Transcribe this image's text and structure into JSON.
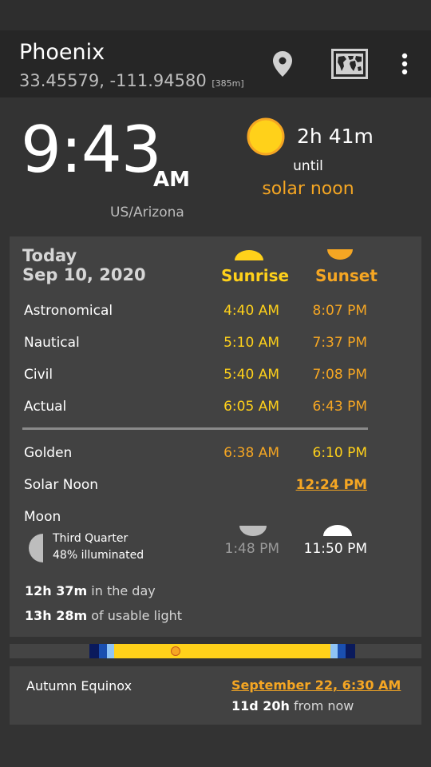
{
  "location": {
    "name": "Phoenix",
    "coordinates": "33.45579, -111.94580",
    "elevation": "[385m]"
  },
  "toolbar_icons": [
    "location-pin-icon",
    "world-map-icon",
    "more-vert-icon"
  ],
  "clock": {
    "time": "9:43",
    "ampm": "AM",
    "timezone": "US/Arizona"
  },
  "next_event": {
    "countdown": "2h 41m",
    "until": "until",
    "target": "solar noon"
  },
  "today": {
    "day_label": "Today",
    "date": "Sep 10, 2020",
    "sunrise_header": "Sunrise",
    "sunset_header": "Sunset",
    "rows": [
      {
        "label": "Astronomical",
        "rise": "4:40 AM",
        "set": "8:07 PM"
      },
      {
        "label": "Nautical",
        "rise": "5:10 AM",
        "set": "7:37 PM"
      },
      {
        "label": "Civil",
        "rise": "5:40 AM",
        "set": "7:08 PM"
      },
      {
        "label": "Actual",
        "rise": "6:05 AM",
        "set": "6:43 PM"
      }
    ],
    "golden": {
      "label": "Golden",
      "evening": "6:38 AM",
      "morning": "6:10 PM"
    },
    "solar_noon": {
      "label": "Solar Noon",
      "time": "12:24 PM"
    },
    "moon": {
      "label": "Moon",
      "phase": "Third Quarter",
      "illumination": "48% illuminated",
      "rise": "1:48 PM",
      "set": "11:50 PM"
    },
    "day_length": {
      "value": "12h 37m",
      "suffix": "in the day"
    },
    "usable_light": {
      "value": "13h 28m",
      "suffix": "of usable light"
    }
  },
  "colors": {
    "sunrise_accent": "#ffd11a",
    "sunset_accent": "#f5a623",
    "background": "#333333",
    "card": "#424242"
  },
  "upcoming": {
    "name": "Autumn Equinox",
    "date": "September 22, 6:30 AM",
    "relative_value": "11d 20h",
    "relative_suffix": "from now"
  }
}
